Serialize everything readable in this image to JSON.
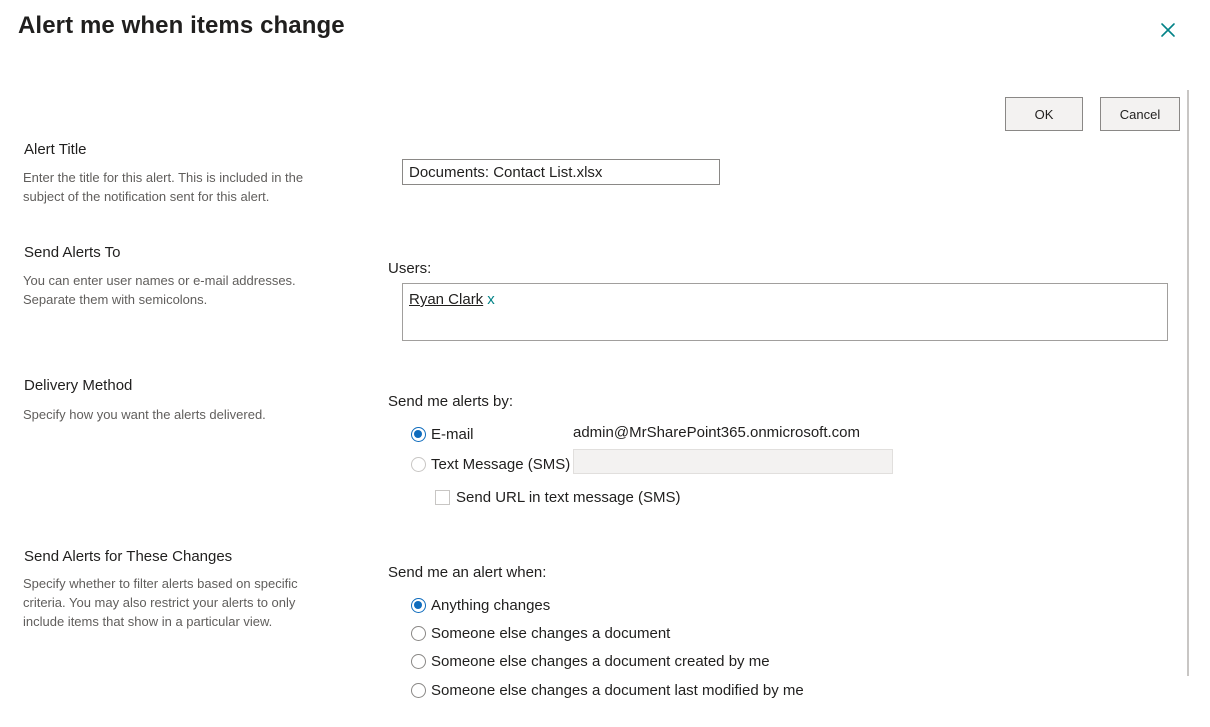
{
  "dialog": {
    "title": "Alert me when items change",
    "close_icon": "close-icon"
  },
  "buttons": {
    "ok_label": "OK",
    "cancel_label": "Cancel"
  },
  "sections": {
    "alert_title": {
      "title": "Alert Title",
      "description": "Enter the title for this alert. This is included in the subject of the notification sent for this alert.",
      "value": "Documents: Contact List.xlsx"
    },
    "send_to": {
      "title": "Send Alerts To",
      "description": "You can enter user names or e-mail addresses. Separate them with semicolons.",
      "users_label": "Users:",
      "users": [
        {
          "name": "Ryan Clark",
          "remove": "x"
        }
      ]
    },
    "delivery": {
      "title": "Delivery Method",
      "description": "Specify how you want the alerts delivered.",
      "label": "Send me alerts by:",
      "email_label": "E-mail",
      "email_value": "admin@MrSharePoint365.onmicrosoft.com",
      "sms_label": "Text Message (SMS)",
      "sms_url_label": "Send URL in text message (SMS)",
      "selected": "email"
    },
    "changes": {
      "title": "Send Alerts for These Changes",
      "description": "Specify whether to filter alerts based on specific criteria. You may also restrict your alerts to only include items that show in a particular view.",
      "label": "Send me an alert when:",
      "options": [
        {
          "label": "Anything changes",
          "checked": true
        },
        {
          "label": "Someone else changes a document",
          "checked": false
        },
        {
          "label": "Someone else changes a document created by me",
          "checked": false
        },
        {
          "label": "Someone else changes a document last modified by me",
          "checked": false
        }
      ]
    }
  },
  "colors": {
    "accent": "#0f6cbd",
    "close_icon": "#038387",
    "remove_link": "#038387"
  }
}
